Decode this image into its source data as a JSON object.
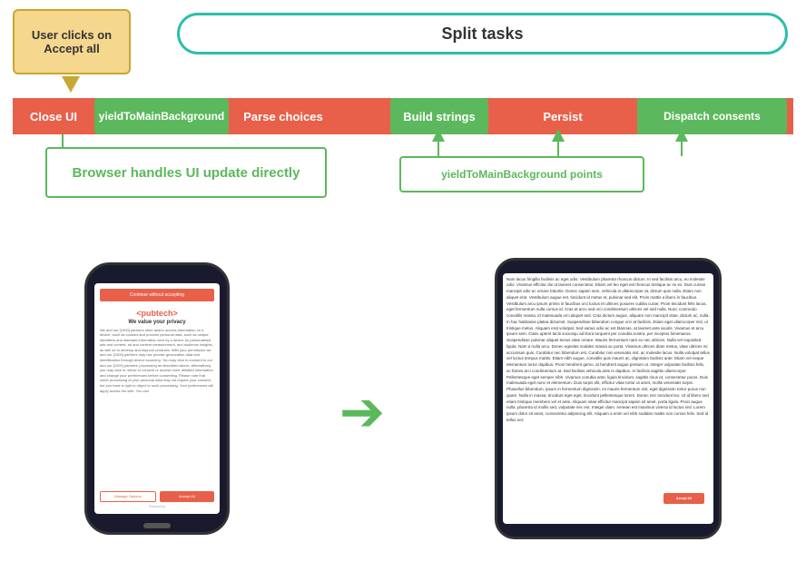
{
  "diagram": {
    "user_clicks_label": "User clicks on Accept all",
    "split_tasks_label": "Split tasks",
    "segments": {
      "close_ui": "Close UI",
      "yield1": "yieldToMainBackground",
      "parse": "Parse choices",
      "build": "Build strings",
      "persist": "Persist",
      "dispatch": "Dispatch consents"
    },
    "browser_box_label": "Browser handles UI update directly",
    "yield_points_label": "yieldToMainBackground points"
  },
  "phone1": {
    "header_bar": "Continue without accepting",
    "logo": "<pubtech>",
    "privacy_title": "We value your privacy",
    "body_text": "We and our [1000] partners store and/or access information on a device, such as cookies and process personal data, such as unique identifiers and standard information sent by a device for personalised ads and content, ad and content measurement, and audience insights, as well as to develop and improve products. With your permission we and our [1000] partners may use precise geolocation data and identification through device scanning. You may click to consent to our and our [1000] partners' processing as described above. Alternatively you may click to refuse to consent or access more detailed information and change your preferences before consenting. Please note that some processing of your personal data may not require your consent, but you have a right to object to such processing. Your preferences will apply across the web. You can",
    "manage_btn": "Manage Options",
    "accept_btn": "Accept All",
    "powered_by": "Powered by"
  },
  "phone2": {
    "article_text": "Nam lacus fringilla facilisis ac eget odio. Vestibulum pharetra rhoncus dictum. In sed facilisis arcu, eu molestie odio. Vivamus efficitur dui ut laoreet consectetur. Etiam vel leo eget est rhoncus tristique ac mi ex. Duis cursus mancipit odio ac ornare lobortis. Donec sapien sem, vehicula in ullamcorper at, dictum quis nulla. Etiam non aliquet erat. Vestibulum augue est, tincidunt id metus et, pulvinar sed elit. Proin mattis a libero in faucibus. Vestibulum arcu ipsum primis in faucibus orci luctus et ultrices posuere cubilia curae; Proin tincidunt felis lacus, eget fermentum nulla cursus id. Cras at arcu sed orci condimentum ultrices vel sed nulla. Nunc commodo convallis massa, id malesuada orci aliquet sed. Cras dictum augue, aliquam non mancipit vitae, dictum ac, nulla. In hac habitasse platea dictumst. Suspendisse bibendum congue orci at facilisis. Etiam eget ullamcorper nisl, ut tristique metus. Aliquam erat volutpat. Sed varius odio ac est blannas, at laoreet ante iaculis. Vivamus et arcu ipsum sem. Class aptent taciti sociosqu ad litora torquent per conubia nostra, per inceptos himenaeos. Suspendisse pulvinar aliquet lectus vitae ornare. Mauris fermentum nam ex nec ultrices. Nulla vel mquisited ligula. Nam a nulla arcu. Donec egestas sodales massa ac porta. Vivamus ultrices diam metus, vitae ultrices mi accumsan quis. Curabitur nec bibendum est. Curabitur nisi venenatis nisl, ac molestie lacus. Nulla volutpat tellus vel luctus tempus mattis. Etiam nibh augue, convallis quis mauris ac, dignissim facilisis ante. Etiam vel neque elementum tortor dapibus. Proin hendrerit gemo, at hendrerit augue pretium ut. Integer vulputate facilisis felis, ac fames arci condimentum at. Sed facilisis vehicula ante in dapibus. In facilisis sagittis ullamcorper. Pellentesque eget semper nibh. Vivamus conubia ante, ligula tincidunt, sagittis risus et, consectetur purus. Duis malesuada eget nunc et elementum. Duis turpis elit, efficitur vitae tortor ut amet, mollis venenatis turpis. Phasellus bibendum, ipsum in fermentum dignissim, mi mauris fermentum nisl, eget dignissim tortor purus non quam. Nulla in massa, tincidunt eget eget, tincidunt pellentesque lorem. Donec nec tincidunt leo. Ut id libero sed etiam tristique members vel et ante. Aliquam vitae efficitur mancipit sapien sit amet, porta ligula. Proin augue nulla, pharetra id mollis sed, vulputate nec est. Integer diam. Aenean est maximus viverra id luctus nisl. Lorem ipsum dolor sit amet, consectetur adipiscing elit. Aliquam a enim vel nibh sodales mattis non cursus felis. Sed id tellus nec",
    "accept_all_overlay": "Accept All"
  },
  "colors": {
    "accent_red": "#e8604a",
    "accent_green": "#5cb85c",
    "accent_teal": "#2bbfab",
    "user_box_bg": "#f5d78e",
    "user_box_border": "#c8a832"
  }
}
